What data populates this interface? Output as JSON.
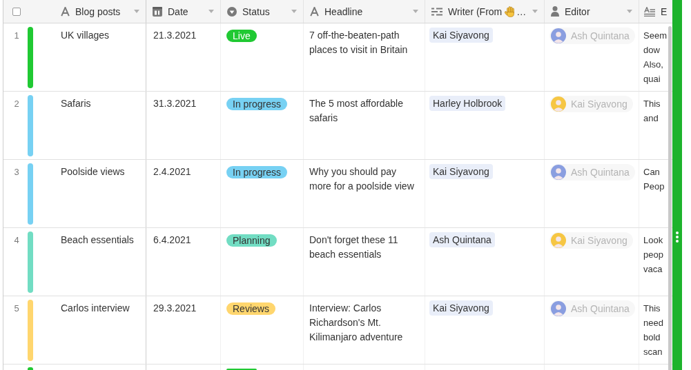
{
  "header_checkbox": {
    "checked": false
  },
  "columns": [
    {
      "label": "Blog posts",
      "kind": "text"
    },
    {
      "label": "Date",
      "kind": "date"
    },
    {
      "label": "Status",
      "kind": "select"
    },
    {
      "label": "Headline",
      "kind": "text"
    },
    {
      "label": "Writer (From",
      "kind": "lookup",
      "emoji": true,
      "ellipsis": "…"
    },
    {
      "label": "Editor",
      "kind": "user"
    },
    {
      "label": "E",
      "kind": "long_text"
    }
  ],
  "rows": [
    {
      "number": "1",
      "color": "#20c933",
      "title": "UK villages",
      "date": "21.3.2021",
      "status": "Live",
      "headline": "7 off-the-beaten-path places to visit in Britain",
      "writer": "Kai Siyavong",
      "editor": {
        "name": "Ash Quintana",
        "color": "#8a9ee0"
      },
      "notes": [
        "Seem",
        "dow",
        "Also,",
        "quai"
      ]
    },
    {
      "number": "2",
      "color": "#77d1f3",
      "title": "Safaris",
      "date": "31.3.2021",
      "status": "In progress",
      "headline": "The 5 most affordable safaris",
      "writer": "Harley Holbrook",
      "editor": {
        "name": "Kai Siyavong",
        "color": "#f6c643"
      },
      "notes": [
        "This",
        "and"
      ]
    },
    {
      "number": "3",
      "color": "#77d1f3",
      "title": "Poolside views",
      "date": "2.4.2021",
      "status": "In progress",
      "headline": "Why you should pay more for a poolside view",
      "writer": "Kai Siyavong",
      "editor": {
        "name": "Ash Quintana",
        "color": "#8a9ee0"
      },
      "notes": [
        "Can",
        "Peop"
      ]
    },
    {
      "number": "4",
      "color": "#72ddc3",
      "title": "Beach essentials",
      "date": "6.4.2021",
      "status": "Planning",
      "headline": "Don't forget these 11 beach essentials",
      "writer": "Ash Quintana",
      "editor": {
        "name": "Kai Siyavong",
        "color": "#f6c643"
      },
      "notes": [
        "Look",
        "peop",
        "vaca"
      ]
    },
    {
      "number": "5",
      "color": "#ffd66e",
      "title": "Carlos interview",
      "date": "29.3.2021",
      "status": "Reviews",
      "headline": "Interview: Carlos Richardson's Mt. Kilimanjaro adventure",
      "writer": "Kai Siyavong",
      "editor": {
        "name": "Ash Quintana",
        "color": "#8a9ee0"
      },
      "notes": [
        "This",
        "need",
        "bold",
        "scan"
      ]
    }
  ],
  "partial_row": {
    "color": "#20c933"
  }
}
